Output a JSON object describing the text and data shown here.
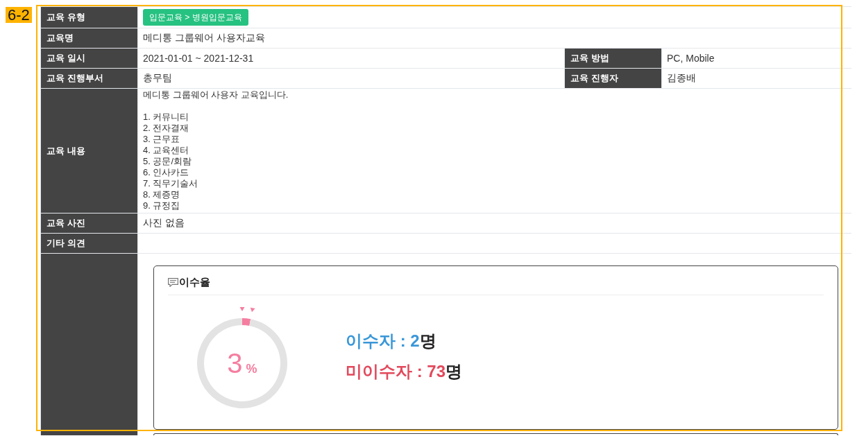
{
  "annotation": {
    "step": "6-2"
  },
  "info_table": {
    "rows": [
      {
        "fields": [
          {
            "label": "교육 유형",
            "kind": "badge",
            "value": "입문교육 > 병원입문교육"
          }
        ]
      },
      {
        "fields": [
          {
            "label": "교육명",
            "kind": "text",
            "value": "메디통 그룹웨어 사용자교육"
          }
        ]
      },
      {
        "fields": [
          {
            "label": "교육 일시",
            "kind": "text",
            "value": "2021-01-01 ~ 2021-12-31"
          },
          {
            "label": "교육 방법",
            "kind": "text",
            "value": "PC, Mobile"
          }
        ]
      },
      {
        "fields": [
          {
            "label": "교육 진행부서",
            "kind": "text",
            "value": "총무팀"
          },
          {
            "label": "교육 진행자",
            "kind": "text",
            "value": "김종배"
          }
        ]
      },
      {
        "fields": [
          {
            "label": "교육 내용",
            "kind": "paragraphs",
            "paragraphs": [
              [
                "메디통 그룹웨어 사용자 교육입니다."
              ],
              [
                "1. 커뮤니티",
                "2. 전자결재",
                "3. 근무표",
                "4. 교육센터",
                "5. 공문/회람",
                "6. 인사카드",
                "7. 직무기술서",
                "8. 제증명",
                "9. 규정집"
              ]
            ]
          }
        ]
      },
      {
        "fields": [
          {
            "label": "교육 사진",
            "kind": "text",
            "value": "사진 없음"
          }
        ]
      },
      {
        "fields": [
          {
            "label": "기타 의견",
            "kind": "empty"
          }
        ]
      },
      {
        "fields": [
          {
            "kind": "completion_card",
            "card": {
              "title": "이수율",
              "chart_data": {
                "type": "donut",
                "values": [
                  3,
                  97
                ]
              },
              "percent": "3",
              "unit": "%",
              "stats": [
                {
                  "label": "이수자 :",
                  "value": "2",
                  "unit": "명",
                  "color": "#3a97d8"
                },
                {
                  "label": "미이수자 :",
                  "value": "73",
                  "unit": "명",
                  "color": "#e24a5c"
                }
              ]
            }
          }
        ]
      }
    ]
  }
}
